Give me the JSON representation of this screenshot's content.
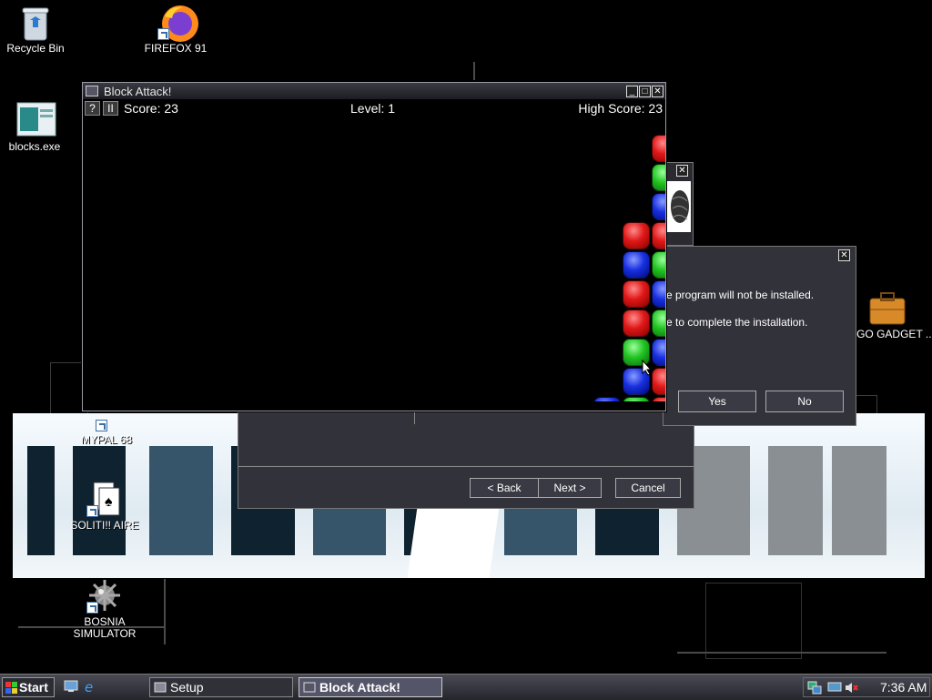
{
  "desktop": {
    "icons": {
      "recycle_bin": "Recycle Bin",
      "firefox": "FIREFOX 91",
      "blocks_exe": "blocks.exe",
      "mypal": "MYPAL 68",
      "solitaire": "SOLITI!! AIRE",
      "bosnia": "BOSNIA SIMULATOR",
      "gogo": "GO GO GADGET ..."
    }
  },
  "game_window": {
    "title": "Block Attack!",
    "help_label": "?",
    "pause_label": "II",
    "score": "Score: 23",
    "level": "Level: 1",
    "high_score": "High Score: 23"
  },
  "confirm_dialog": {
    "line1": "e program will not be installed.",
    "line2": "e to complete the installation.",
    "yes": "Yes",
    "no": "No"
  },
  "setup_wizard": {
    "back": "< Back",
    "next": "Next >",
    "cancel": "Cancel"
  },
  "taskbar": {
    "start": "Start",
    "tasks": [
      "Setup",
      "Block Attack!"
    ],
    "clock": "7:36 AM"
  },
  "icons": [
    "recycle-bin-icon",
    "firefox-icon",
    "exe-icon",
    "briefcase-icon",
    "cards-icon",
    "mine-icon",
    "windows-flag-icon",
    "ie-icon",
    "desktop-icon",
    "network-icon",
    "speaker-muted-icon"
  ]
}
